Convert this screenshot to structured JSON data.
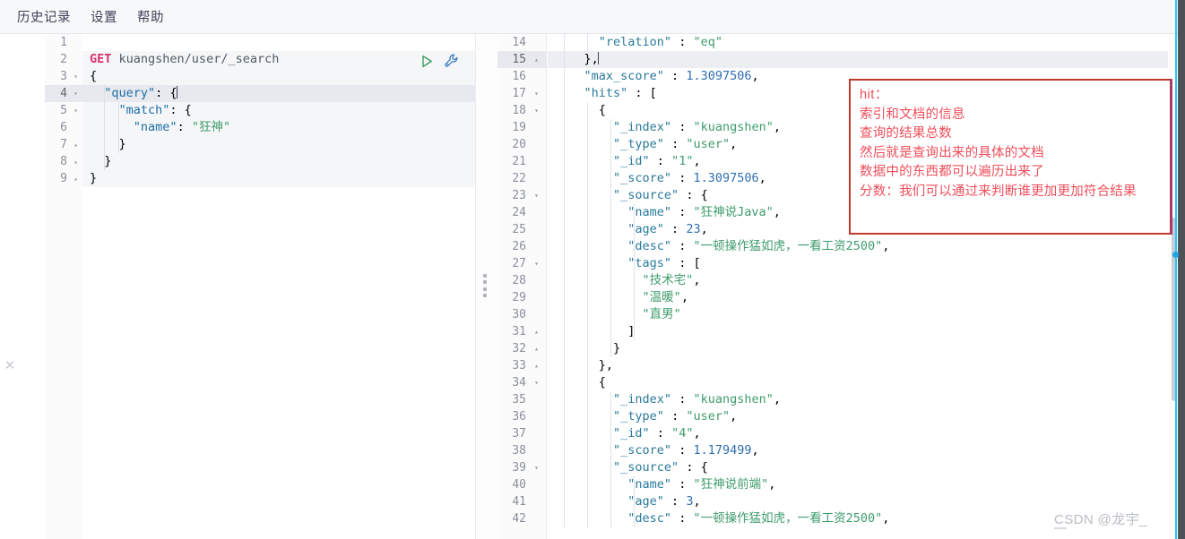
{
  "window": {
    "accent_cyan": "#29c5f6",
    "annotation_border": "#c0392b",
    "annotation_text_color": "#ef4d5a"
  },
  "menubar": {
    "items": [
      {
        "label": "历史记录",
        "name": "menu-history"
      },
      {
        "label": "设置",
        "name": "menu-settings"
      },
      {
        "label": "帮助",
        "name": "menu-help"
      }
    ]
  },
  "request_editor": {
    "name": "request-editor",
    "active_line": 4,
    "play_tooltip": "click to send request",
    "wrench_tooltip": "open documentation",
    "lines": [
      {
        "n": 1,
        "fold": "",
        "text": ""
      },
      {
        "n": 2,
        "fold": "",
        "text": "GET kuangshen/user/_search"
      },
      {
        "n": 3,
        "fold": "▾",
        "text": "{"
      },
      {
        "n": 4,
        "fold": "▾",
        "text": "  \"query\": {"
      },
      {
        "n": 5,
        "fold": "▾",
        "text": "    \"match\": {"
      },
      {
        "n": 6,
        "fold": "",
        "text": "      \"name\": \"狂神\""
      },
      {
        "n": 7,
        "fold": "▴",
        "text": "    }"
      },
      {
        "n": 8,
        "fold": "▴",
        "text": "  }"
      },
      {
        "n": 9,
        "fold": "▴",
        "text": "}"
      }
    ]
  },
  "response_editor": {
    "name": "response-editor",
    "active_line": 15,
    "lines": [
      {
        "n": 14,
        "fold": "",
        "text": "      \"relation\" : \"eq\""
      },
      {
        "n": 15,
        "fold": "▴",
        "text": "    },"
      },
      {
        "n": 16,
        "fold": "",
        "text": "    \"max_score\" : 1.3097506,"
      },
      {
        "n": 17,
        "fold": "▾",
        "text": "    \"hits\" : ["
      },
      {
        "n": 18,
        "fold": "▾",
        "text": "      {"
      },
      {
        "n": 19,
        "fold": "",
        "text": "        \"_index\" : \"kuangshen\","
      },
      {
        "n": 20,
        "fold": "",
        "text": "        \"_type\" : \"user\","
      },
      {
        "n": 21,
        "fold": "",
        "text": "        \"_id\" : \"1\","
      },
      {
        "n": 22,
        "fold": "",
        "text": "        \"_score\" : 1.3097506,"
      },
      {
        "n": 23,
        "fold": "▾",
        "text": "        \"_source\" : {"
      },
      {
        "n": 24,
        "fold": "",
        "text": "          \"name\" : \"狂神说Java\","
      },
      {
        "n": 25,
        "fold": "",
        "text": "          \"age\" : 23,"
      },
      {
        "n": 26,
        "fold": "",
        "text": "          \"desc\" : \"一顿操作猛如虎，一看工资2500\","
      },
      {
        "n": 27,
        "fold": "▾",
        "text": "          \"tags\" : ["
      },
      {
        "n": 28,
        "fold": "",
        "text": "            \"技术宅\","
      },
      {
        "n": 29,
        "fold": "",
        "text": "            \"温暖\","
      },
      {
        "n": 30,
        "fold": "",
        "text": "            \"直男\""
      },
      {
        "n": 31,
        "fold": "▴",
        "text": "          ]"
      },
      {
        "n": 32,
        "fold": "▴",
        "text": "        }"
      },
      {
        "n": 33,
        "fold": "▴",
        "text": "      },"
      },
      {
        "n": 34,
        "fold": "▾",
        "text": "      {"
      },
      {
        "n": 35,
        "fold": "",
        "text": "        \"_index\" : \"kuangshen\","
      },
      {
        "n": 36,
        "fold": "",
        "text": "        \"_type\" : \"user\","
      },
      {
        "n": 37,
        "fold": "",
        "text": "        \"_id\" : \"4\","
      },
      {
        "n": 38,
        "fold": "",
        "text": "        \"_score\" : 1.179499,"
      },
      {
        "n": 39,
        "fold": "▾",
        "text": "        \"_source\" : {"
      },
      {
        "n": 40,
        "fold": "",
        "text": "          \"name\" : \"狂神说前端\","
      },
      {
        "n": 41,
        "fold": "",
        "text": "          \"age\" : 3,"
      },
      {
        "n": 42,
        "fold": "",
        "text": "          \"desc\" : \"一顿操作猛如虎，一看工资2500\","
      }
    ]
  },
  "response_data": {
    "max_score": 1.3097506,
    "relation": "eq",
    "hits": [
      {
        "_index": "kuangshen",
        "_type": "user",
        "_id": "1",
        "_score": 1.3097506,
        "_source": {
          "name": "狂神说Java",
          "age": 23,
          "desc": "一顿操作猛如虎，一看工资2500",
          "tags": [
            "技术宅",
            "温暖",
            "直男"
          ]
        }
      },
      {
        "_index": "kuangshen",
        "_type": "user",
        "_id": "4",
        "_score": 1.179499,
        "_source": {
          "name": "狂神说前端",
          "age": 3,
          "desc": "一顿操作猛如虎，一看工资2500"
        }
      }
    ]
  },
  "annotation": {
    "name": "red-annotation-box",
    "lines": [
      "hit：",
      "索引和文档的信息",
      "查询的结果总数",
      "然后就是查询出来的具体的文档",
      "数据中的东西都可以遍历出来了",
      "分数：我们可以通过来判断谁更加更加符合结果"
    ]
  },
  "watermark": {
    "text": "CSDN @龙宇_"
  }
}
